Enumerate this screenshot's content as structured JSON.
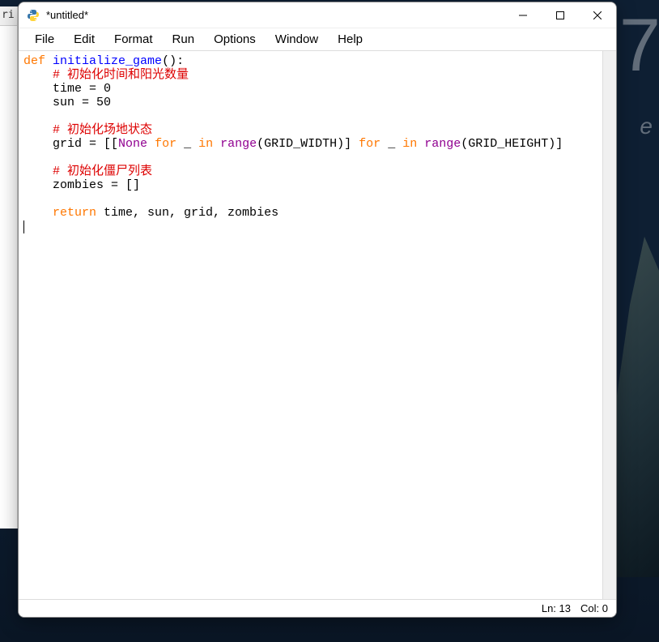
{
  "desktop": {
    "partial_clock": "7",
    "partial_sub": "e"
  },
  "left_fragment": "ri",
  "window": {
    "title": "*untitled*"
  },
  "menubar": {
    "items": [
      "File",
      "Edit",
      "Format",
      "Run",
      "Options",
      "Window",
      "Help"
    ]
  },
  "code": {
    "l1_def": "def",
    "l1_fn": "initialize_game",
    "l1_rest": "():",
    "l2_indent": "    ",
    "l2_comment": "# 初始化时间和阳光数量",
    "l3": "    time = 0",
    "l4": "    sun = 50",
    "l5": "",
    "l6_indent": "    ",
    "l6_comment": "# 初始化场地状态",
    "l7_a": "    grid = [[",
    "l7_none": "None",
    "l7_b": " ",
    "l7_for1": "for",
    "l7_c": " _ ",
    "l7_in1": "in",
    "l7_d": " ",
    "l7_range1": "range",
    "l7_e": "(GRID_WIDTH)] ",
    "l7_for2": "for",
    "l7_f": " _ ",
    "l7_in2": "in",
    "l7_g": " ",
    "l7_range2": "range",
    "l7_h": "(GRID_HEIGHT)]",
    "l8": "",
    "l9_indent": "    ",
    "l9_comment": "# 初始化僵尸列表",
    "l10": "    zombies = []",
    "l11": "",
    "l12_indent": "    ",
    "l12_return": "return",
    "l12_rest": " time, sun, grid, zombies"
  },
  "status": {
    "line_label": "Ln:",
    "line_val": "13",
    "col_label": "Col:",
    "col_val": "0"
  }
}
